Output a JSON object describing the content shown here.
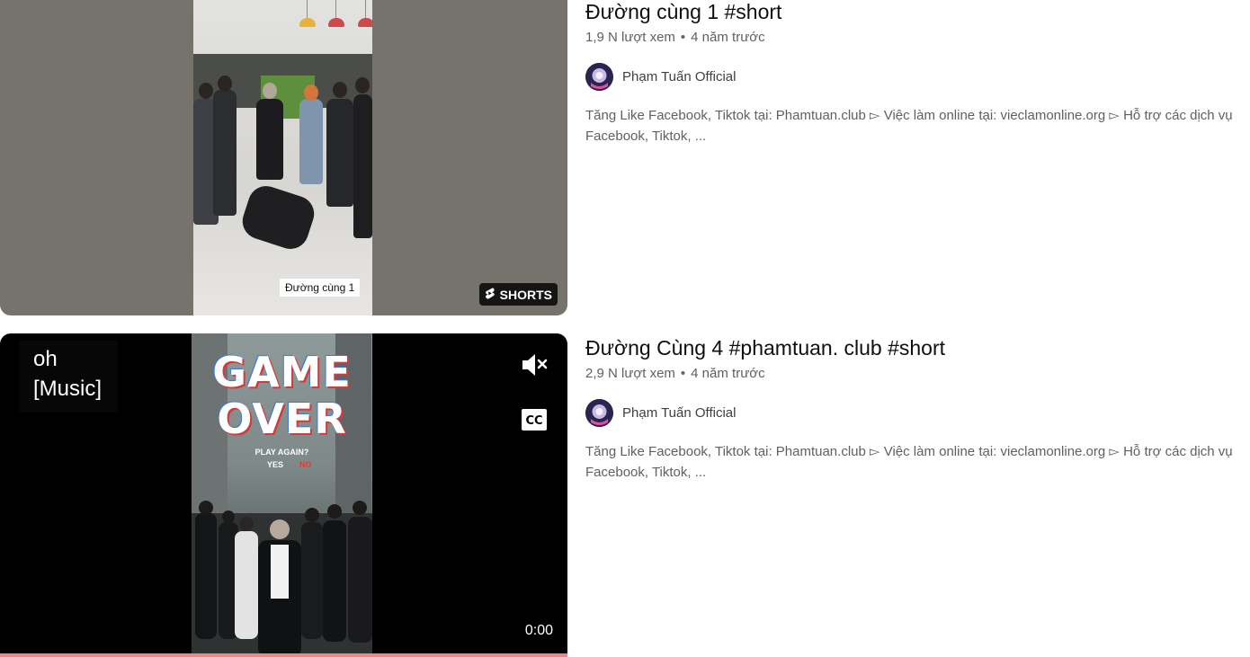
{
  "results": [
    {
      "title": "Đường cùng 1 #short",
      "views": "1,9 N lượt xem",
      "separator": "•",
      "age": "4 năm trước",
      "channel": "Phạm Tuấn Official",
      "description": "Tăng Like Facebook, Tiktok tại: Phamtuan.club ▻ Việc làm online tại: vieclamonline.org ▻ Hỗ trợ các dịch vụ Facebook, Tiktok, ...",
      "thumbnail": {
        "caption": "Đường cùng 1",
        "badge": "SHORTS",
        "badge_icon": "shorts-icon"
      }
    },
    {
      "title": "Đường Cùng 4 #phamtuan. club #short",
      "views": "2,9 N lượt xem",
      "separator": "•",
      "age": "4 năm trước",
      "channel": "Phạm Tuấn Official",
      "description": "Tăng Like Facebook, Tiktok tại: Phamtuan.club ▻ Việc làm online tại: vieclamonline.org ▻ Hỗ trợ các dịch vụ Facebook, Tiktok, ...",
      "thumbnail": {
        "caption_line1": "oh",
        "caption_line2": "[Music]",
        "overlay_line1": "GAME",
        "overlay_line2": "OVER",
        "overlay_prompt": "PLAY AGAIN?",
        "overlay_yes": "YES",
        "overlay_no": "NO",
        "time": "0:00",
        "progress": 0.0,
        "mute_icon": "mute-icon",
        "cc_icon": "closed-captions-icon"
      }
    }
  ],
  "colors": {
    "progress": "#ff0000",
    "meta_text": "#606060",
    "title_text": "#0f0f0f"
  }
}
